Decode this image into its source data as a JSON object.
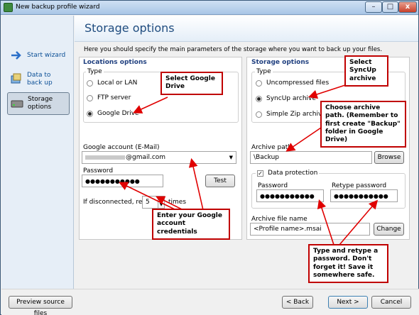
{
  "window": {
    "title": "New backup profile wizard",
    "minimize": "–",
    "maximize": "□",
    "close": "x"
  },
  "sidebar": {
    "items": [
      {
        "label": "Start wizard",
        "icon": "arrow-right-icon"
      },
      {
        "label": "Data to back up",
        "icon": "data-folder-icon"
      },
      {
        "label": "Storage options",
        "icon": "drive-icon"
      }
    ]
  },
  "header": {
    "title": "Storage options"
  },
  "intro": "Here you should specify the main parameters of the storage where you want to back up your files.",
  "locations": {
    "section_title": "Locations options",
    "type_legend": "Type",
    "options": [
      "Local or LAN",
      "FTP server",
      "Google Drive"
    ],
    "selected": "Google Drive",
    "account_label": "Google account (E-Mail)",
    "account_value": "@gmail.com",
    "password_label": "Password",
    "password_value": "●●●●●●●●●●●",
    "test_button": "Test",
    "retry_label": "If disconnected, retry",
    "retry_value": "5",
    "times_label": "times"
  },
  "storage": {
    "section_title": "Storage options",
    "type_legend": "Type",
    "options": [
      "Uncompressed files",
      "SyncUp archive",
      "Simple Zip archive"
    ],
    "selected": "SyncUp archive",
    "archive_path_label": "Archive path",
    "archive_path_value": "\\Backup",
    "browse_button": "Browse",
    "protection_label": "Data protection",
    "protection_checked": "✓",
    "password_label": "Password",
    "password_value": "●●●●●●●●●●●",
    "retype_label": "Retype password",
    "retype_value": "●●●●●●●●●●●",
    "file_name_label": "Archive file name",
    "file_name_value": "<Profile name>.msai",
    "change_button": "Change"
  },
  "footer": {
    "preview": "Preview source files",
    "back": "< Back",
    "next": "Next >",
    "cancel": "Cancel"
  },
  "callouts": {
    "google": "Select Google Drive",
    "syncup": "Select SyncUp archive",
    "archive_path": "Choose archive path. (Remember to first create \"Backup\" folder in Google Drive)",
    "credentials": "Enter your Google account credentials",
    "password": "Type and retype a password. Don't forget it! Save it somewhere safe."
  },
  "colors": {
    "accent": "#1f4c7f",
    "callout_border": "#c00000",
    "arrow": "#e00000"
  }
}
